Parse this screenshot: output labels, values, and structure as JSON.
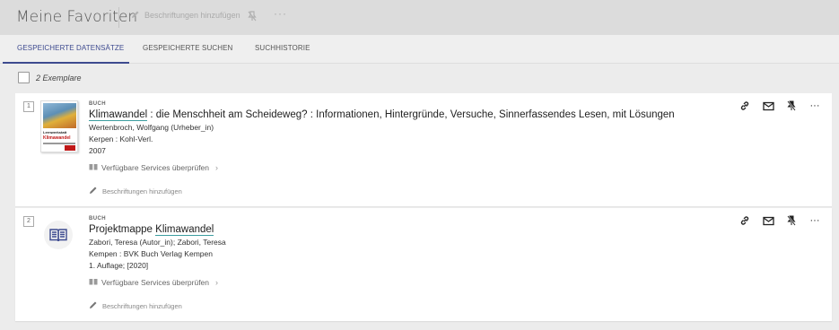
{
  "header": {
    "title": "Meine Favoriten",
    "add_labels": "Beschriftungen hinzufügen",
    "more": "···"
  },
  "tabs": [
    {
      "label": "GESPEICHERTE DATENSÄTZE",
      "active": true
    },
    {
      "label": "GESPEICHERTE SUCHEN",
      "active": false
    },
    {
      "label": "SUCHHISTORIE",
      "active": false
    }
  ],
  "list": {
    "count_text": "2 Exemplare"
  },
  "records": [
    {
      "index": "1",
      "type": "BUCH",
      "title_highlight": "Klimawandel",
      "title_rest": " : die Menschheit am Scheideweg? : Informationen, Hintergründe, Versuche, Sinnerfassendes Lesen, mit Lösungen",
      "lines": [
        "Wertenbroch, Wolfgang (Urheber_in)",
        "Kerpen : Kohl-Verl.",
        "2007"
      ],
      "services": "Verfügbare Services überprüfen",
      "add_labels": "Beschriftungen hinzufügen",
      "cover": {
        "line1": "Lernwerkstatt",
        "line2": "Klimawandel"
      }
    },
    {
      "index": "2",
      "type": "BUCH",
      "title_prefix": "Projektmappe ",
      "title_highlight": "Klimawandel",
      "lines": [
        "Zabori, Teresa (Autor_in); Zabori, Teresa",
        "Kempen : BVK Buch Verlag Kempen",
        "1. Auflage; [2020]"
      ],
      "services": "Verfügbare Services überprüfen",
      "add_labels": "Beschriftungen hinzufügen"
    }
  ],
  "colors": {
    "accent": "#3d4a8f",
    "highlight_underline": "#3d9ea0",
    "cover_red": "#c01818"
  },
  "icons": [
    "pencil-icon",
    "pin-off-icon",
    "link-icon",
    "mail-icon",
    "book-icon",
    "chevron-right-icon",
    "more-icon"
  ]
}
